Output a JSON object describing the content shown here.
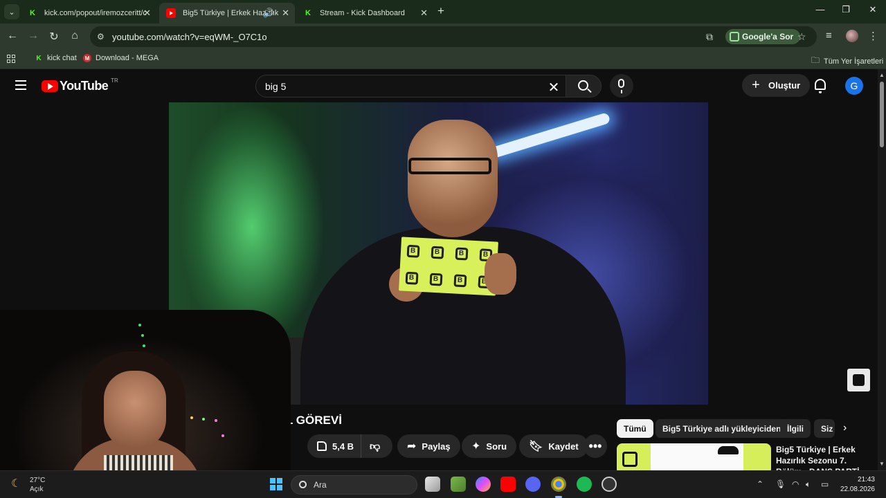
{
  "browser": {
    "tabs": [
      {
        "title": "kick.com/popout/iremozceritt/c",
        "favicon": "kick-icon",
        "active": false
      },
      {
        "title": "Big5 Türkiye | Erkek Hazırlık",
        "favicon": "youtube-icon",
        "active": true
      },
      {
        "title": "Stream - Kick Dashboard",
        "favicon": "kick-icon",
        "active": false
      }
    ],
    "address": "youtube.com/watch?v=eqWM-_O7C1o",
    "google_ask": "Google'a Sor",
    "bookmarks": [
      {
        "label": "kick chat",
        "icon": "kick-icon"
      },
      {
        "label": "Download - MEGA",
        "icon": "mega-icon"
      }
    ],
    "all_bookmarks": "Tüm Yer İşaretleri"
  },
  "youtube": {
    "logo_text": "YouTube",
    "country_code": "TR",
    "search_query": "big 5",
    "create_label": "Oluştur",
    "avatar_letter": "G",
    "video_title_visible": "L GÖREVİ",
    "likes": "5,4 B",
    "share_label": "Paylaş",
    "ask_label": "Soru",
    "save_label": "Kaydet",
    "chips": [
      "Tümü",
      "Big5 Türkiye adlı yükleyiciden",
      "İlgili",
      "Siz"
    ],
    "recommended": [
      {
        "title": "Big5 Türkiye | Erkek Hazırlık Sezonu 7. Bölüm - DANS PARTİ"
      }
    ]
  },
  "taskbar": {
    "weather_temp": "27°C",
    "weather_status": "Açık",
    "search_placeholder": "Ara",
    "time": "21:43",
    "date": "22.08.2026"
  },
  "colors": {
    "browser_frame": "#2e3a2d",
    "youtube_bg": "#0f0f0f",
    "youtube_red": "#ff0000",
    "kick_green": "#53fc18",
    "big5_yellow": "#d8f05a"
  }
}
